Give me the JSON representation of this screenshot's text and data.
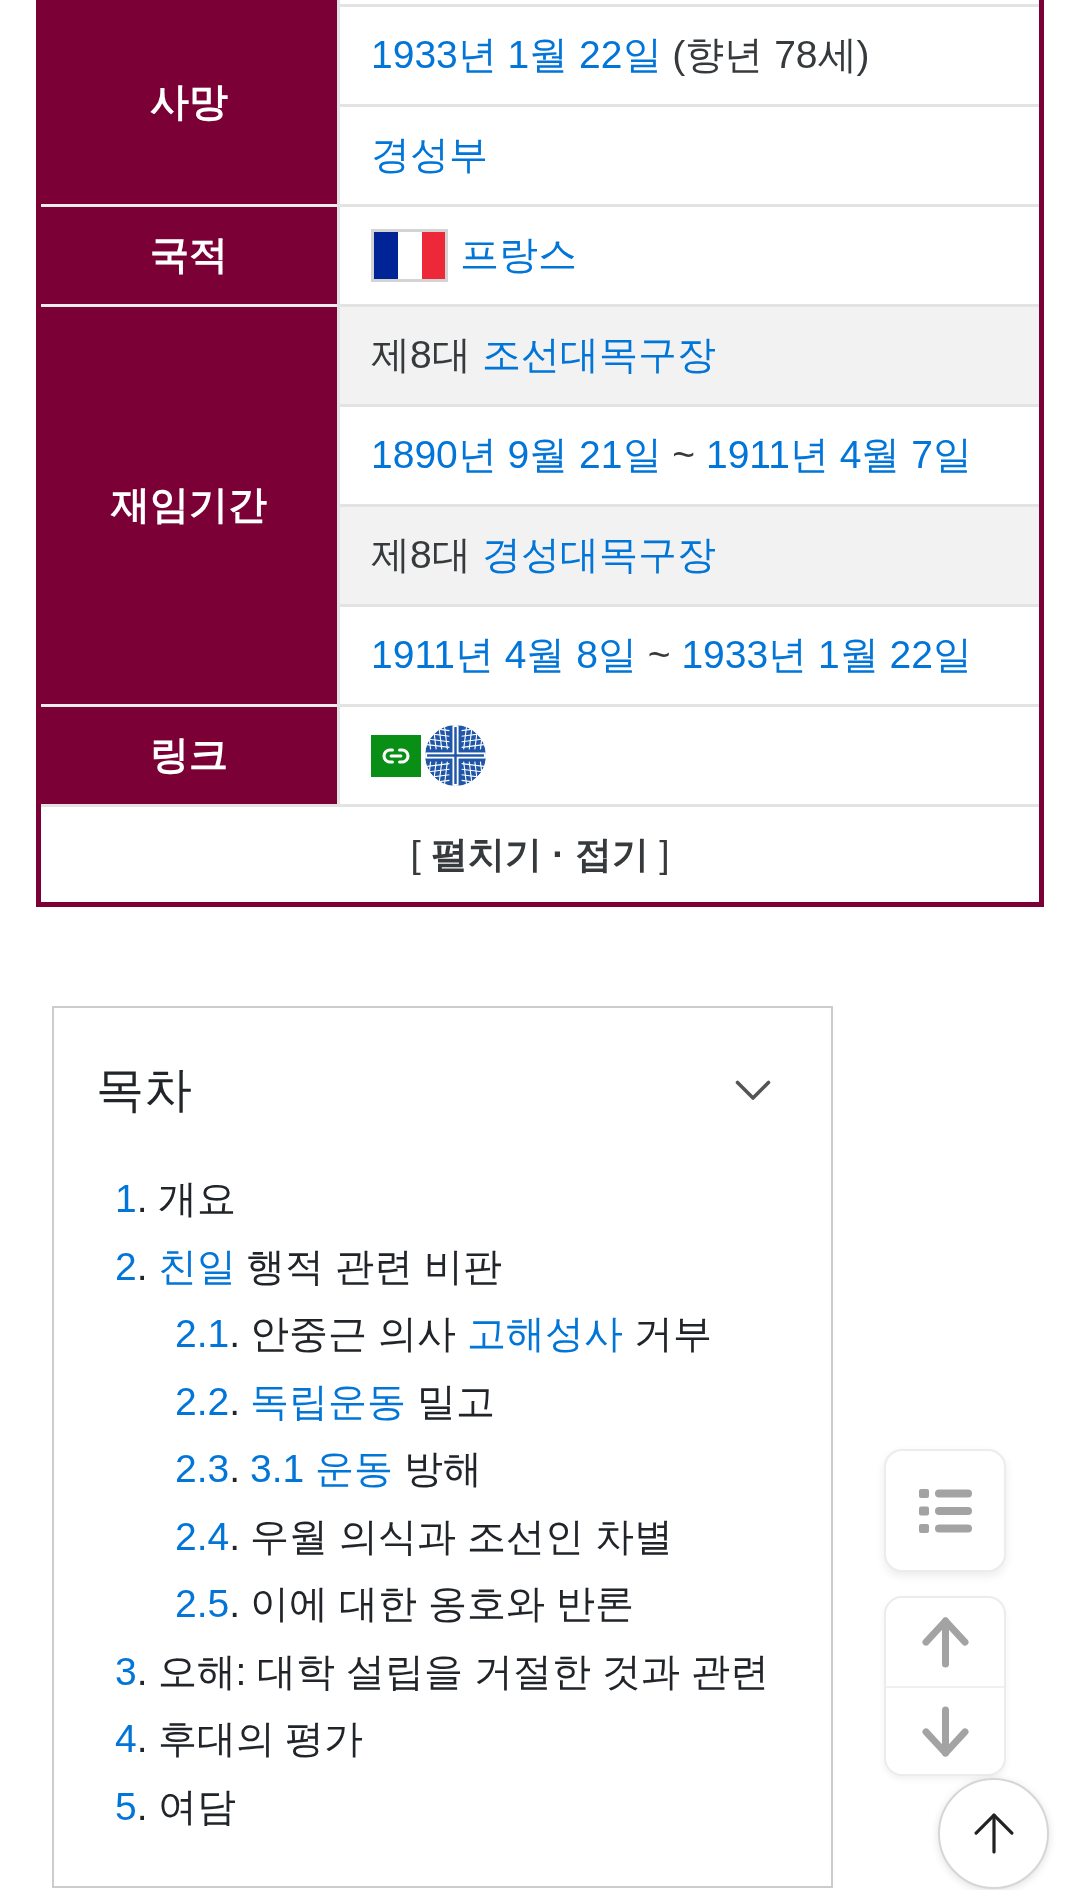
{
  "infobox": {
    "groups": [
      {
        "label": "사망",
        "rows": [
          {
            "kind": "text",
            "shaded": false,
            "parts": [
              {
                "kind": "link",
                "text": "1933년 1월 22일"
              },
              {
                "kind": "text",
                "text": " (향년 78세)"
              }
            ]
          },
          {
            "kind": "text",
            "shaded": false,
            "parts": [
              {
                "kind": "link",
                "text": "경성부"
              }
            ]
          }
        ]
      },
      {
        "label": "국적",
        "rows": [
          {
            "kind": "flag",
            "shaded": false,
            "parts": [
              {
                "kind": "link",
                "text": "프랑스"
              }
            ]
          }
        ]
      },
      {
        "label": "재임기간",
        "rows": [
          {
            "kind": "text",
            "shaded": true,
            "parts": [
              {
                "kind": "text",
                "text": "제8대 "
              },
              {
                "kind": "link",
                "text": "조선대목구장"
              }
            ]
          },
          {
            "kind": "text",
            "shaded": false,
            "parts": [
              {
                "kind": "link",
                "text": "1890년 9월 21일"
              },
              {
                "kind": "text",
                "text": " ~ "
              },
              {
                "kind": "link",
                "text": "1911년 4월 7일"
              }
            ]
          },
          {
            "kind": "text",
            "shaded": true,
            "parts": [
              {
                "kind": "text",
                "text": "제8대 "
              },
              {
                "kind": "link",
                "text": "경성대목구장"
              }
            ]
          },
          {
            "kind": "text",
            "shaded": false,
            "parts": [
              {
                "kind": "link",
                "text": "1911년 4월 8일"
              },
              {
                "kind": "text",
                "text": " ~ "
              },
              {
                "kind": "link",
                "text": "1933년 1월 22일"
              }
            ]
          }
        ]
      },
      {
        "label": "링크",
        "rows": [
          {
            "kind": "external_links",
            "shaded": false
          }
        ]
      }
    ],
    "toggle": "[ **펼치기 · 접기** ]"
  },
  "toc": {
    "title": "목차",
    "expanded": true,
    "entries": [
      {
        "number": "1",
        "suffix": ".",
        "parts": [
          {
            "kind": "text",
            "text": "개요"
          }
        ]
      },
      {
        "number": "2",
        "suffix": ".",
        "parts": [
          {
            "kind": "link",
            "text": "친일"
          },
          {
            "kind": "text",
            "text": " 행적 관련 비판"
          }
        ],
        "children": [
          {
            "number": "2.1",
            "suffix": ".",
            "parts": [
              {
                "kind": "text",
                "text": "안중근 의사 "
              },
              {
                "kind": "link",
                "text": "고해성사"
              },
              {
                "kind": "text",
                "text": " 거부"
              }
            ]
          },
          {
            "number": "2.2",
            "suffix": ".",
            "parts": [
              {
                "kind": "link",
                "text": "독립운동"
              },
              {
                "kind": "text",
                "text": " 밀고"
              }
            ]
          },
          {
            "number": "2.3",
            "suffix": ".",
            "parts": [
              {
                "kind": "link",
                "text": "3.1 운동"
              },
              {
                "kind": "text",
                "text": " 방해"
              }
            ]
          },
          {
            "number": "2.4",
            "suffix": ".",
            "parts": [
              {
                "kind": "text",
                "text": "우월 의식과 조선인 차별"
              }
            ]
          },
          {
            "number": "2.5",
            "suffix": ".",
            "parts": [
              {
                "kind": "text",
                "text": "이에 대한 옹호와 반론"
              }
            ]
          }
        ]
      },
      {
        "number": "3",
        "suffix": ".",
        "parts": [
          {
            "kind": "text",
            "text": "오해: 대학 설립을 거절한 것과 관련"
          }
        ]
      },
      {
        "number": "4",
        "suffix": ".",
        "parts": [
          {
            "kind": "text",
            "text": "후대의 평가"
          }
        ]
      },
      {
        "number": "5",
        "suffix": ".",
        "parts": [
          {
            "kind": "text",
            "text": "여담"
          }
        ]
      }
    ]
  }
}
